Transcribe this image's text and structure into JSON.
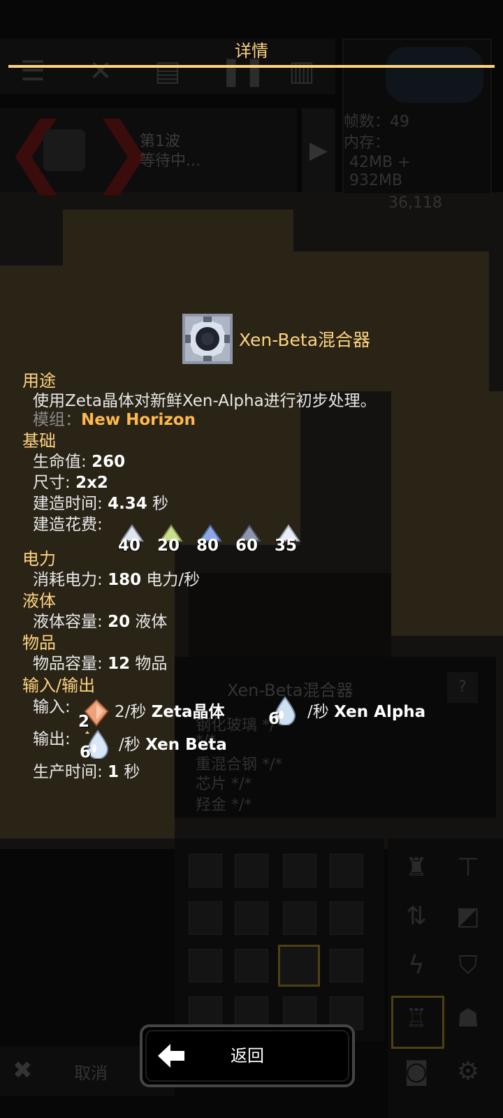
{
  "dialog": {
    "title": "详情",
    "back_label": "返回"
  },
  "background": {
    "wave_title": "第1波",
    "wave_status": "等待中...",
    "fps_label": "帧数：49",
    "memory_label": "内存：",
    "memory_value1": "42MB +",
    "memory_value2": "932MB",
    "coords": "36,118",
    "info_title": "Xen-Beta混合器",
    "info_help": "?",
    "info_lines": [
      "钢化玻璃 */*",
      "*/*",
      "重混合钢 */*",
      "芯片 */*",
      "羟金 */*"
    ],
    "cancel_label": "取消"
  },
  "block": {
    "name": "Xen-Beta混合器",
    "icon": "xen-beta-mixer-icon"
  },
  "usage": {
    "header": "用途",
    "description": "使用Zeta晶体对新鲜Xen-Alpha进行初步处理。",
    "mod_label": "模组：",
    "mod_name": "New Horizon"
  },
  "base": {
    "header": "基础",
    "health_label": "生命值:",
    "health_value": "260",
    "size_label": "尺寸:",
    "size_value": "2x2",
    "buildtime_label": "建造时间:",
    "buildtime_value": "4.34",
    "buildtime_unit": "秒",
    "cost_label": "建造花费:",
    "costs": [
      {
        "amount": "40",
        "icon": "silver-ingot-icon",
        "color": "#dfe5ee"
      },
      {
        "amount": "20",
        "icon": "green-ingot-icon",
        "color": "#c8df8c"
      },
      {
        "amount": "80",
        "icon": "blue-ingot-icon",
        "color": "#8ea8e6"
      },
      {
        "amount": "60",
        "icon": "dark-ingot-icon",
        "color": "#8e96ad"
      },
      {
        "amount": "35",
        "icon": "white-ingot-icon",
        "color": "#e7eef8"
      }
    ]
  },
  "power": {
    "header": "电力",
    "use_label": "消耗电力:",
    "use_value": "180",
    "use_unit": "电力/秒"
  },
  "liquid": {
    "header": "液体",
    "cap_label": "液体容量:",
    "cap_value": "20",
    "cap_unit": "液体"
  },
  "items": {
    "header": "物品",
    "cap_label": "物品容量:",
    "cap_value": "12",
    "cap_unit": "物品"
  },
  "io": {
    "header": "输入/输出",
    "input_label": "输入:",
    "inputs": [
      {
        "amount": "2",
        "rate": "2/秒",
        "name": "Zeta晶体",
        "icon": "zeta-crystal-icon",
        "color": "#f0a07a"
      },
      {
        "amount": "6",
        "rate": "/秒",
        "name": "Xen Alpha",
        "icon": "xen-alpha-drop-icon",
        "color": "#cfe0f2"
      }
    ],
    "output_label": "输出:",
    "outputs": [
      {
        "amount": "6",
        "rate": "/秒",
        "name": "Xen Beta",
        "icon": "xen-beta-drop-icon",
        "color": "#d8e6f5"
      }
    ],
    "time_label": "生产时间:",
    "time_value": "1",
    "time_unit": "秒"
  }
}
